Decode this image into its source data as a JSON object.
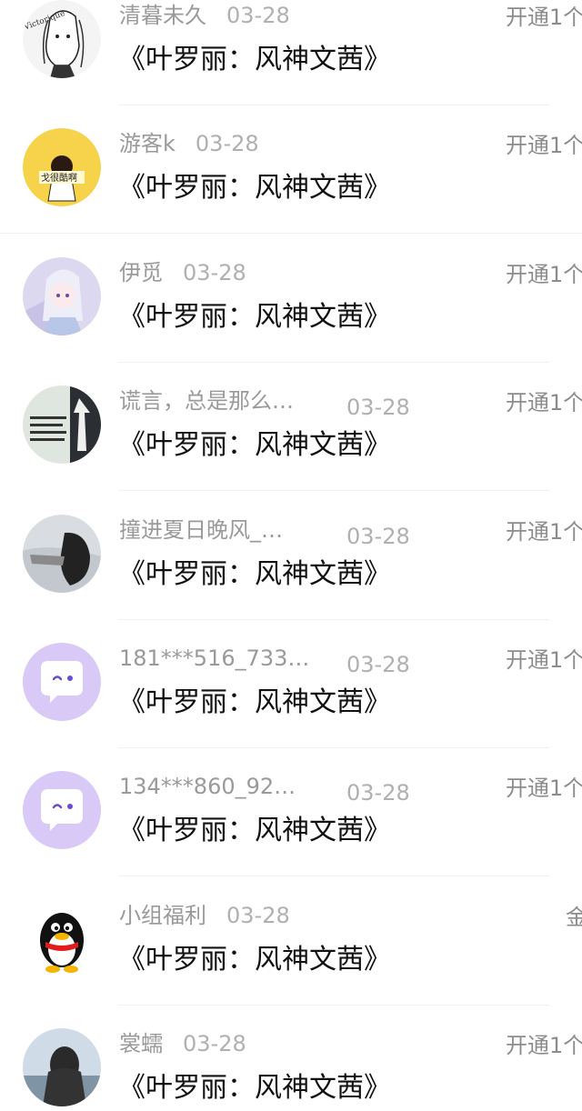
{
  "feed": {
    "items": [
      {
        "name": "清暮未久",
        "date": "03-28",
        "title": "《叶罗丽：风神文茜》",
        "right": "开通1个",
        "avatar": "anime-ink-avatar"
      },
      {
        "name": "游客k",
        "date": "03-28",
        "title": "《叶罗丽：风神文茜》",
        "right": "开通1个",
        "avatar": "yellow-sticker-avatar"
      },
      {
        "name": "伊觅",
        "date": "03-28",
        "title": "《叶罗丽：风神文茜》",
        "right": "开通1个",
        "avatar": "anime-girl-avatar"
      },
      {
        "name": "谎言，总是那么…",
        "date": "03-28",
        "title": "《叶罗丽：风神文茜》",
        "right": "开通1个",
        "avatar": "text-photo-avatar"
      },
      {
        "name": "撞进夏日晚风_…",
        "date": "03-28",
        "title": "《叶罗丽：风神文茜》",
        "right": "开通1个",
        "avatar": "snow-cat-avatar"
      },
      {
        "name": "181***516_733…",
        "date": "03-28",
        "title": "《叶罗丽：风神文茜》",
        "right": "开通1个",
        "avatar": "default-chat-avatar"
      },
      {
        "name": "134***860_92…",
        "date": "03-28",
        "title": "《叶罗丽：风神文茜》",
        "right": "开通1个",
        "avatar": "default-chat-avatar"
      },
      {
        "name": "小组福利",
        "date": "03-28",
        "title": "《叶罗丽：风神文茜》",
        "right": "金",
        "avatar": "penguin-avatar"
      },
      {
        "name": "裳蠕",
        "date": "03-28",
        "title": "《叶罗丽：风神文茜》",
        "right": "开通1个",
        "avatar": "girl-back-avatar"
      }
    ]
  }
}
